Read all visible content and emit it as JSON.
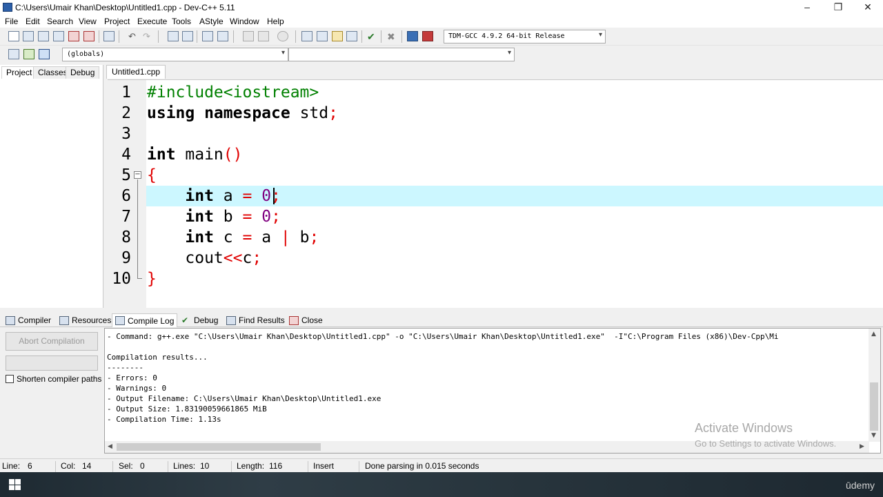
{
  "window": {
    "title": "C:\\Users\\Umair Khan\\Desktop\\Untitled1.cpp - Dev-C++ 5.11",
    "minimize": "–",
    "restore": "❐",
    "close": "✕"
  },
  "menu": [
    "File",
    "Edit",
    "Search",
    "View",
    "Project",
    "Execute",
    "Tools",
    "AStyle",
    "Window",
    "Help"
  ],
  "toolbar": {
    "compiler_select": "TDM-GCC 4.9.2 64-bit Release",
    "scope_select": "(globals)",
    "member_select": ""
  },
  "left_tabs": [
    "Project",
    "Classes",
    "Debug"
  ],
  "editor_tab": "Untitled1.cpp",
  "code": {
    "line_numbers": [
      "1",
      "2",
      "3",
      "4",
      "5",
      "6",
      "7",
      "8",
      "9",
      "10"
    ],
    "l1": "#include<iostream>",
    "l2_kw": "using namespace",
    "l2_id": " std",
    "l2_semi": ";",
    "l4_kw": "int",
    "l4_id": " main",
    "l4_paren": "()",
    "l5": "{",
    "l6_kw": "int",
    "l6_id": " a ",
    "l6_eq": "=",
    "l6_sp": " ",
    "l6_num": "0",
    "l6_semi": ";",
    "l7_kw": "int",
    "l7_id": " b ",
    "l7_eq": "=",
    "l7_sp": " ",
    "l7_num": "0",
    "l7_semi": ";",
    "l8_kw": "int",
    "l8_id": " c ",
    "l8_eq": "=",
    "l8_id2": " a ",
    "l8_op": "|",
    "l8_id3": " b",
    "l8_semi": ";",
    "l9_id": "cout",
    "l9_op": "<<",
    "l9_id2": "c",
    "l9_semi": ";",
    "l10": "}"
  },
  "bottom_tabs": [
    "Compiler",
    "Resources",
    "Compile Log",
    "Debug",
    "Find Results",
    "Close"
  ],
  "compile_panel": {
    "abort_button": "Abort Compilation",
    "shorten_label": "Shorten compiler paths",
    "log": [
      "- Command: g++.exe \"C:\\Users\\Umair Khan\\Desktop\\Untitled1.cpp\" -o \"C:\\Users\\Umair Khan\\Desktop\\Untitled1.exe\"  -I\"C:\\Program Files (x86)\\Dev-Cpp\\Mi",
      "",
      "Compilation results...",
      "--------",
      "- Errors: 0",
      "- Warnings: 0",
      "- Output Filename: C:\\Users\\Umair Khan\\Desktop\\Untitled1.exe",
      "- Output Size: 1.83190059661865 MiB",
      "- Compilation Time: 1.13s"
    ]
  },
  "watermark": {
    "line1": "Activate Windows",
    "line2": "Go to Settings to activate Windows."
  },
  "status": {
    "line_label": "Line:",
    "line_value": "6",
    "col_label": "Col:",
    "col_value": "14",
    "sel_label": "Sel:",
    "sel_value": "0",
    "lines_label": "Lines:",
    "lines_value": "10",
    "length_label": "Length:",
    "length_value": "116",
    "mode": "Insert",
    "message": "Done parsing in 0.015 seconds"
  },
  "taskbar": {
    "brand": "ūdemy"
  }
}
